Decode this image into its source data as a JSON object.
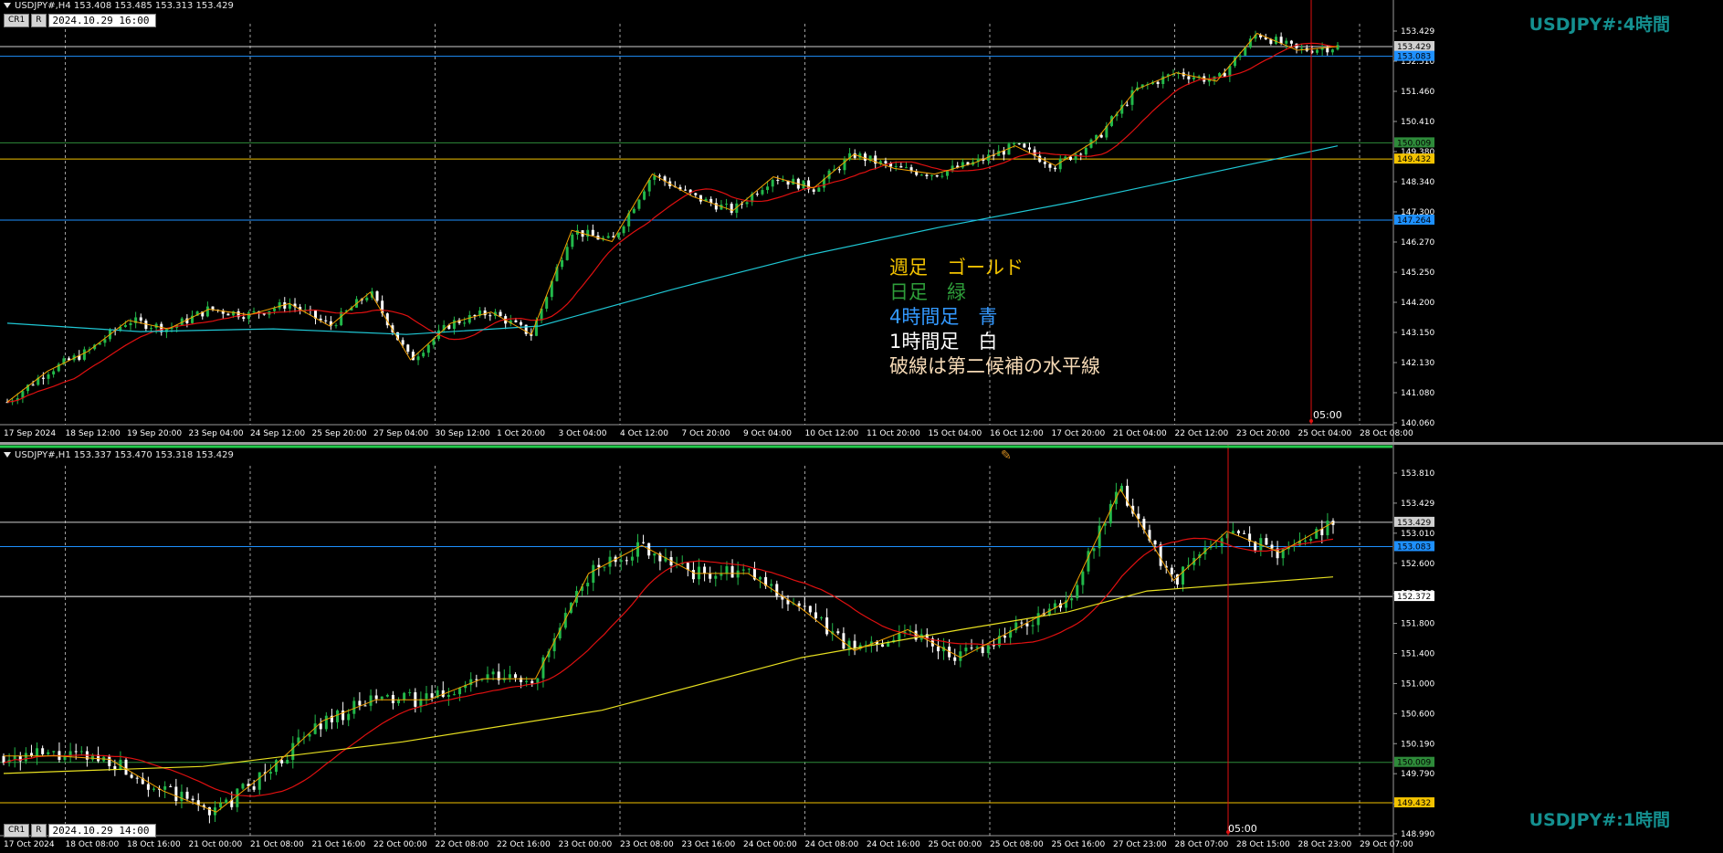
{
  "h4": {
    "header": "USDJPY#,H4  153.408 153.485 153.313 153.429",
    "crosshair_btn": "CR1",
    "r_btn": "R",
    "date": "2024.10.29 16:00",
    "title": "USDJPY#:4時間",
    "time_marker": "05:00",
    "price_scale": [
      "153.429",
      "152.510",
      "151.460",
      "150.410",
      "149.380",
      "148.340",
      "147.300",
      "146.270",
      "145.250",
      "144.200",
      "143.150",
      "142.130",
      "141.080",
      "140.060"
    ],
    "price_tags": [
      {
        "text": "153.429",
        "color": "#ffffff",
        "fg": "#000000"
      },
      {
        "text": "153.083",
        "color": "#1e90ff",
        "fg": "#000000"
      },
      {
        "text": "150.009",
        "color": "#2e8b3a",
        "fg": "#000000"
      },
      {
        "text": "149.432",
        "color": "#f2c200",
        "fg": "#000000"
      },
      {
        "text": "147.264",
        "color": "#1e90ff",
        "fg": "#000000"
      }
    ],
    "time_labels": [
      "17 Sep 2024",
      "18 Sep 12:00",
      "19 Sep 20:00",
      "23 Sep 04:00",
      "24 Sep 12:00",
      "25 Sep 20:00",
      "27 Sep 04:00",
      "30 Sep 12:00",
      "1 Oct 20:00",
      "3 Oct 04:00",
      "4 Oct 12:00",
      "7 Oct 20:00",
      "9 Oct 04:00",
      "10 Oct 12:00",
      "11 Oct 20:00",
      "15 Oct 04:00",
      "16 Oct 12:00",
      "17 Oct 20:00",
      "21 Oct 04:00",
      "22 Oct 12:00",
      "23 Oct 20:00",
      "25 Oct 04:00",
      "28 Oct 08:00"
    ],
    "legend": [
      {
        "text": "週足　ゴールド",
        "color": "#f2c200"
      },
      {
        "text": "日足　緑",
        "color": "#2e9e3a"
      },
      {
        "text": "4時間足　青",
        "color": "#3399ff"
      },
      {
        "text": "1時間足　白",
        "color": "#ffffff"
      },
      {
        "text": "破線は第二候補の水平線",
        "color": "#f5d9b5"
      }
    ]
  },
  "h1": {
    "header": "USDJPY#,H1  153.337 153.470 153.318 153.429",
    "crosshair_btn": "CR1",
    "r_btn": "R",
    "date": "2024.10.29 14:00",
    "title": "USDJPY#:1時間",
    "time_marker": "05:00",
    "price_scale": [
      "153.810",
      "153.429",
      "153.010",
      "152.600",
      "152.200",
      "151.800",
      "151.400",
      "151.000",
      "150.600",
      "150.190",
      "149.790",
      "149.390",
      "148.990"
    ],
    "price_tags": [
      {
        "text": "153.429",
        "color": "#ffffff",
        "fg": "#000000"
      },
      {
        "text": "153.083",
        "color": "#1e90ff",
        "fg": "#000000"
      },
      {
        "text": "152.372",
        "color": "#ffffff",
        "fg": "#000000"
      },
      {
        "text": "150.009",
        "color": "#2e8b3a",
        "fg": "#000000"
      },
      {
        "text": "149.432",
        "color": "#f2c200",
        "fg": "#000000"
      }
    ],
    "time_labels": [
      "17 Oct 2024",
      "18 Oct 08:00",
      "18 Oct 16:00",
      "21 Oct 00:00",
      "21 Oct 08:00",
      "21 Oct 16:00",
      "22 Oct 00:00",
      "22 Oct 08:00",
      "22 Oct 16:00",
      "23 Oct 00:00",
      "23 Oct 08:00",
      "23 Oct 16:00",
      "24 Oct 00:00",
      "24 Oct 08:00",
      "24 Oct 16:00",
      "25 Oct 00:00",
      "25 Oct 08:00",
      "25 Oct 16:00",
      "27 Oct 23:00",
      "28 Oct 07:00",
      "28 Oct 15:00",
      "28 Oct 23:00",
      "29 Oct 07:00"
    ]
  },
  "colors": {
    "bull": "#22b84a",
    "bear": "#ffffff",
    "ma_red": "#e01010",
    "ma_cyan": "#1fc7d4",
    "ma_yellow": "#e8e020",
    "zigzag": "#f2a000",
    "grid": "#c8c8c8",
    "vline_red": "#e01010"
  },
  "chart_data": [
    {
      "type": "line",
      "title": "USDJPY#:4時間",
      "price_range": [
        140.06,
        153.98
      ],
      "series": [
        {
          "name": "",
          "values": [
            140.8,
            141.9,
            142.6,
            143.7,
            143.4,
            144.1,
            143.9,
            144.3,
            143.5,
            144.7,
            142.3,
            143.6,
            144.0,
            143.2,
            146.9,
            146.5,
            148.9,
            148.1,
            147.6,
            148.8,
            148.4,
            149.6,
            149.1,
            148.9,
            149.3,
            149.9,
            149.2,
            150.1,
            151.9,
            152.5,
            152.2,
            153.9,
            153.3,
            153.429
          ]
        }
      ]
    },
    {
      "type": "line",
      "title": "USDJPY#:1時間",
      "price_range": [
        148.99,
        154.13
      ],
      "series": [
        {
          "name": "",
          "values": [
            150.1,
            150.1,
            150.05,
            149.6,
            149.3,
            149.9,
            150.6,
            150.9,
            150.9,
            151.2,
            151.2,
            152.7,
            153.1,
            152.7,
            152.7,
            152.2,
            151.6,
            151.9,
            151.5,
            151.9,
            152.3,
            153.9,
            152.6,
            153.3,
            153.0,
            153.429
          ]
        }
      ]
    }
  ]
}
